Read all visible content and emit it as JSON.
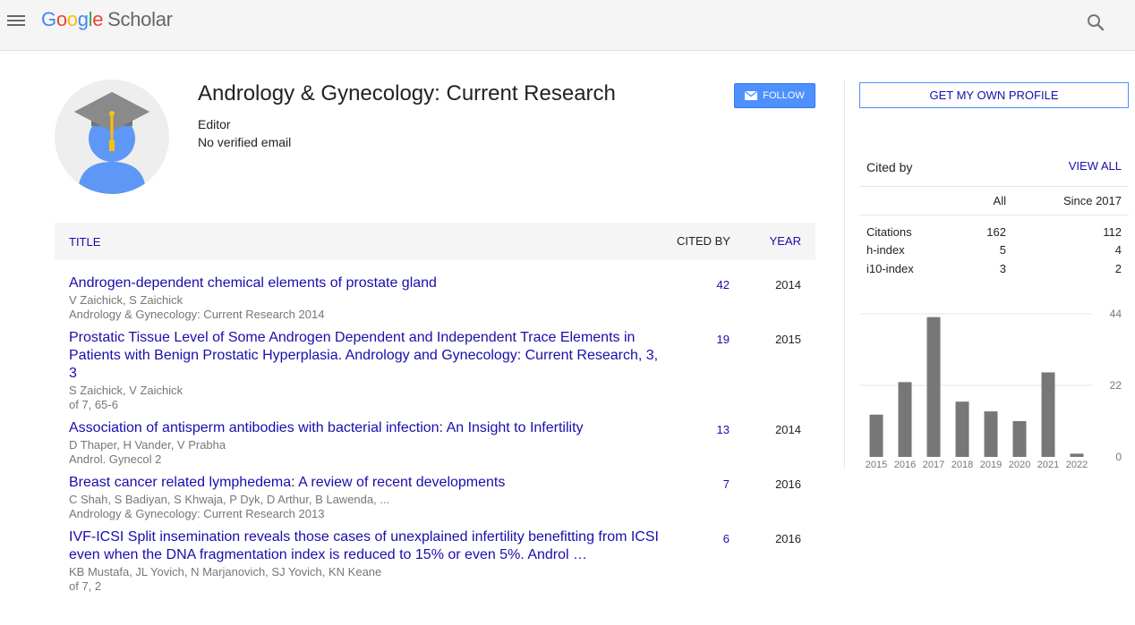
{
  "header": {
    "logo_letters": [
      "G",
      "o",
      "o",
      "g",
      "l",
      "e"
    ],
    "logo_product": "Scholar",
    "menu_icon": "hamburger-menu-icon",
    "search_icon": "search-icon"
  },
  "profile": {
    "name": "Andrology & Gynecology: Current Research",
    "role": "Editor",
    "email": "No verified email",
    "follow_label": "FOLLOW"
  },
  "table": {
    "headers": {
      "title": "TITLE",
      "cited_by": "CITED BY",
      "year": "YEAR"
    },
    "rows": [
      {
        "title": "Androgen-dependent chemical elements of prostate gland",
        "authors": "V Zaichick, S Zaichick",
        "venue": "Andrology & Gynecology: Current Research 2014",
        "cited": "42",
        "year": "2014"
      },
      {
        "title": "Prostatic Tissue Level of Some Androgen Dependent and Independent Trace Elements in Patients with Benign Prostatic Hyperplasia. Andrology and Gynecology: Current Research, 3, 3",
        "authors": "S Zaichick, V Zaichick",
        "venue": "of 7, 65-6",
        "cited": "19",
        "year": "2015"
      },
      {
        "title": "Association of antisperm antibodies with bacterial infection: An Insight to Infertility",
        "authors": "D Thaper, H Vander, V Prabha",
        "venue": "Androl. Gynecol 2",
        "cited": "13",
        "year": "2014"
      },
      {
        "title": "Breast cancer related lymphedema: A review of recent developments",
        "authors": "C Shah, S Badiyan, S Khwaja, P Dyk, D Arthur, B Lawenda, ...",
        "venue": "Andrology & Gynecology: Current Research 2013",
        "cited": "7",
        "year": "2016"
      },
      {
        "title": "IVF-ICSI Split insemination reveals those cases of unexplained infertility benefitting from ICSI even when the DNA fragmentation index is reduced to 15% or even 5%. Androl …",
        "authors": "KB Mustafa, JL Yovich, N Marjanovich, SJ Yovich, KN Keane",
        "venue": "of 7, 2",
        "cited": "6",
        "year": "2016"
      }
    ]
  },
  "sidebar": {
    "own_profile_label": "GET MY OWN PROFILE",
    "cited_by_label": "Cited by",
    "view_all_label": "VIEW ALL",
    "col_all": "All",
    "col_since": "Since 2017",
    "stats": [
      {
        "label": "Citations",
        "all": "162",
        "since": "112"
      },
      {
        "label": "h-index",
        "all": "5",
        "since": "4"
      },
      {
        "label": "i10-index",
        "all": "3",
        "since": "2"
      }
    ]
  },
  "chart_data": {
    "type": "bar",
    "categories": [
      "2015",
      "2016",
      "2017",
      "2018",
      "2019",
      "2020",
      "2021",
      "2022"
    ],
    "values": [
      13,
      23,
      43,
      17,
      14,
      11,
      26,
      1
    ],
    "yticks": [
      0,
      22,
      44
    ],
    "ylim": [
      0,
      44
    ],
    "bar_color": "#777777",
    "grid": true
  }
}
